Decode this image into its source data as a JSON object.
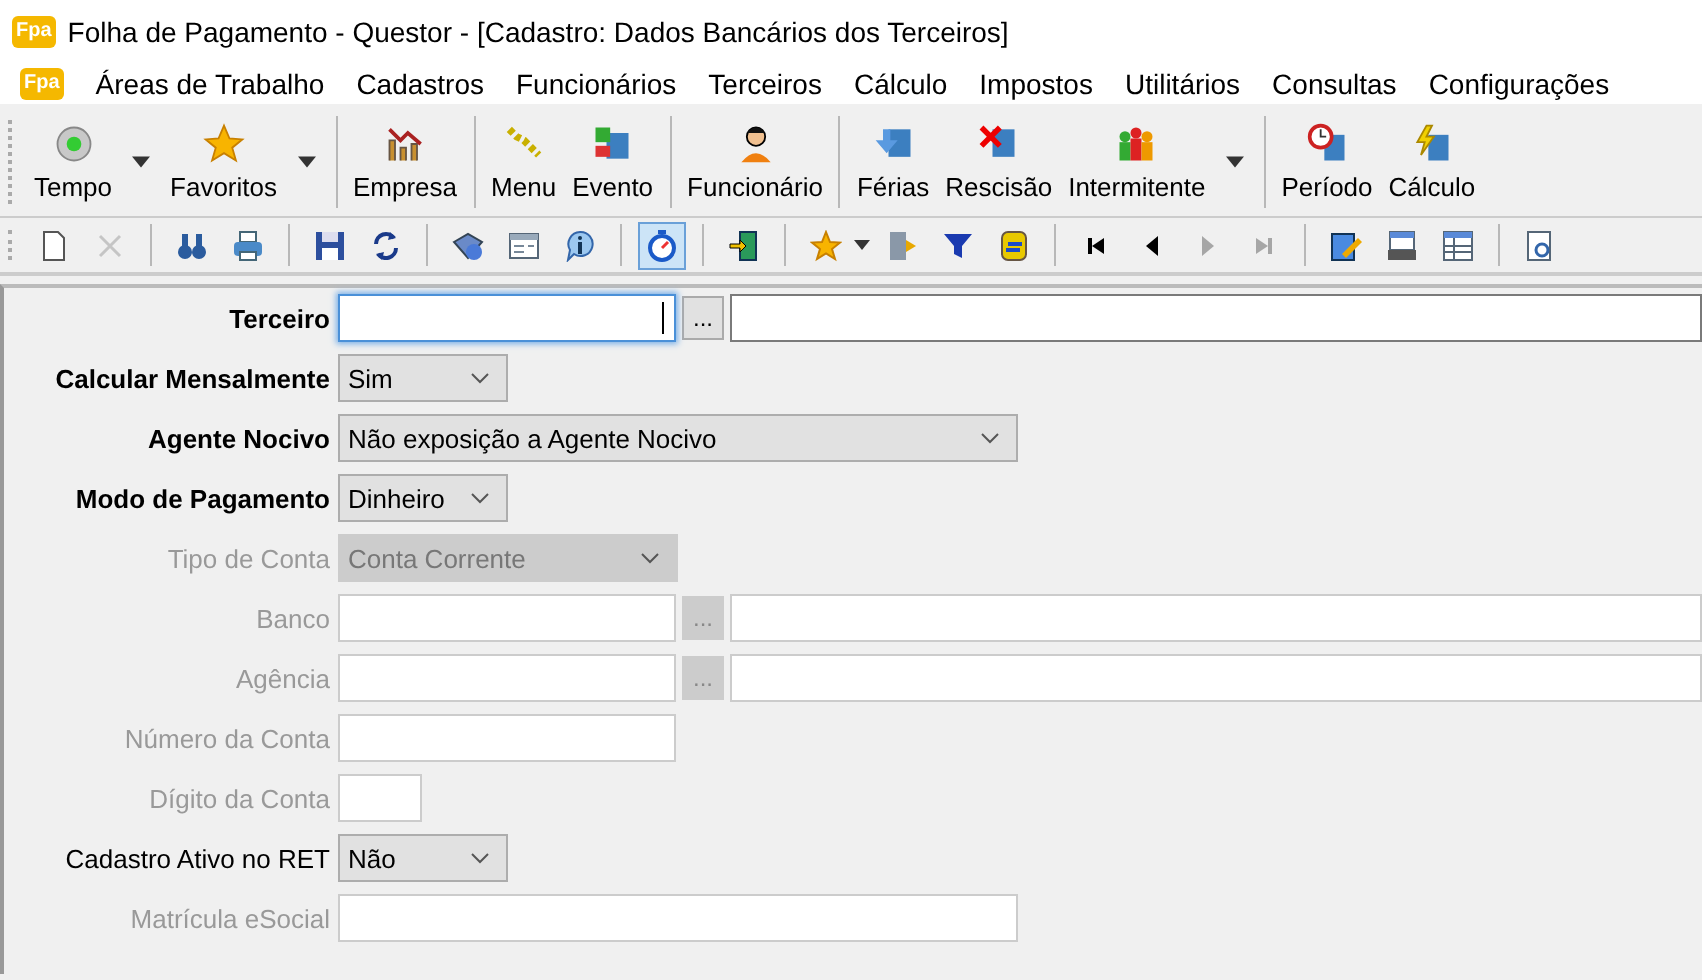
{
  "window": {
    "logo_text": "Fpa",
    "title": "Folha de Pagamento - Questor - [Cadastro: Dados Bancários dos Terceiros]"
  },
  "menu": {
    "logo_text": "Fpa",
    "items": [
      "Áreas de Trabalho",
      "Cadastros",
      "Funcionários",
      "Terceiros",
      "Cálculo",
      "Impostos",
      "Utilitários",
      "Consultas",
      "Configurações"
    ]
  },
  "toolbar": {
    "groups": [
      {
        "items": [
          {
            "label": "Tempo",
            "dropdown": true
          },
          {
            "label": "Favoritos",
            "dropdown": true
          }
        ]
      },
      {
        "items": [
          {
            "label": "Empresa",
            "dropdown": false
          }
        ]
      },
      {
        "items": [
          {
            "label": "Menu",
            "dropdown": false
          },
          {
            "label": "Evento",
            "dropdown": false
          }
        ]
      },
      {
        "items": [
          {
            "label": "Funcionário",
            "dropdown": false
          }
        ]
      },
      {
        "items": [
          {
            "label": "Férias",
            "dropdown": false
          },
          {
            "label": "Rescisão",
            "dropdown": false
          },
          {
            "label": "Intermitente",
            "dropdown": true
          }
        ]
      },
      {
        "items": [
          {
            "label": "Período",
            "dropdown": false
          },
          {
            "label": "Cálculo",
            "dropdown": false
          }
        ]
      }
    ]
  },
  "small_toolbar": {
    "groups": [
      {
        "items": [
          {
            "disabled": false,
            "selected": false,
            "dropdown": false
          },
          {
            "disabled": true,
            "selected": false,
            "dropdown": false
          }
        ]
      },
      {
        "items": [
          {
            "disabled": false,
            "selected": false,
            "dropdown": false
          },
          {
            "disabled": false,
            "selected": false,
            "dropdown": false
          }
        ]
      },
      {
        "items": [
          {
            "disabled": false,
            "selected": false,
            "dropdown": false
          },
          {
            "disabled": false,
            "selected": false,
            "dropdown": false
          }
        ]
      },
      {
        "items": [
          {
            "disabled": false,
            "selected": false,
            "dropdown": false
          },
          {
            "disabled": false,
            "selected": false,
            "dropdown": false
          },
          {
            "disabled": false,
            "selected": false,
            "dropdown": false
          }
        ]
      },
      {
        "items": [
          {
            "disabled": false,
            "selected": true,
            "dropdown": false
          }
        ]
      },
      {
        "items": [
          {
            "disabled": false,
            "selected": false,
            "dropdown": false
          }
        ]
      },
      {
        "items": [
          {
            "disabled": false,
            "selected": false,
            "dropdown": true
          },
          {
            "disabled": false,
            "selected": false,
            "dropdown": false
          },
          {
            "disabled": false,
            "selected": false,
            "dropdown": false
          },
          {
            "disabled": false,
            "selected": false,
            "dropdown": false
          }
        ]
      },
      {
        "items": [
          {
            "disabled": false,
            "selected": false,
            "dropdown": false
          },
          {
            "disabled": false,
            "selected": false,
            "dropdown": false
          },
          {
            "disabled": true,
            "selected": false,
            "dropdown": false
          },
          {
            "disabled": true,
            "selected": false,
            "dropdown": false
          }
        ]
      },
      {
        "items": [
          {
            "disabled": false,
            "selected": false,
            "dropdown": false
          },
          {
            "disabled": false,
            "selected": false,
            "dropdown": false
          },
          {
            "disabled": false,
            "selected": false,
            "dropdown": false
          }
        ]
      },
      {
        "items": [
          {
            "disabled": false,
            "selected": false,
            "dropdown": false
          }
        ]
      }
    ]
  },
  "form": {
    "rows": [
      {
        "kind": "lookup",
        "label": "Terceiro",
        "required": true,
        "disabled": false,
        "focused": true,
        "button_label": "..."
      },
      {
        "kind": "select",
        "label": "Calcular Mensalmente",
        "required": true,
        "disabled": false,
        "value": "Sim"
      },
      {
        "kind": "wide_select",
        "label": "Agente Nocivo",
        "required": true,
        "disabled": false,
        "value": "Não exposição a Agente Nocivo"
      },
      {
        "kind": "select",
        "label": "Modo de Pagamento",
        "required": true,
        "disabled": false,
        "value": "Dinheiro"
      },
      {
        "kind": "medium_select",
        "label": "Tipo de Conta",
        "required": false,
        "disabled": true,
        "value": "Conta Corrente"
      },
      {
        "kind": "lookup",
        "label": "Banco",
        "required": false,
        "disabled": true,
        "focused": false,
        "button_label": "..."
      },
      {
        "kind": "lookup",
        "label": "Agência",
        "required": false,
        "disabled": true,
        "focused": false,
        "button_label": "..."
      },
      {
        "kind": "text",
        "label": "Número da Conta",
        "required": false,
        "disabled": true
      },
      {
        "kind": "short_text",
        "label": "Dígito da Conta",
        "required": false,
        "disabled": true
      },
      {
        "kind": "select",
        "label": "Cadastro Ativo no RET",
        "required": false,
        "disabled": false,
        "value": "Não"
      },
      {
        "kind": "long_text",
        "label": "Matrícula eSocial",
        "required": false,
        "disabled": true
      }
    ]
  }
}
